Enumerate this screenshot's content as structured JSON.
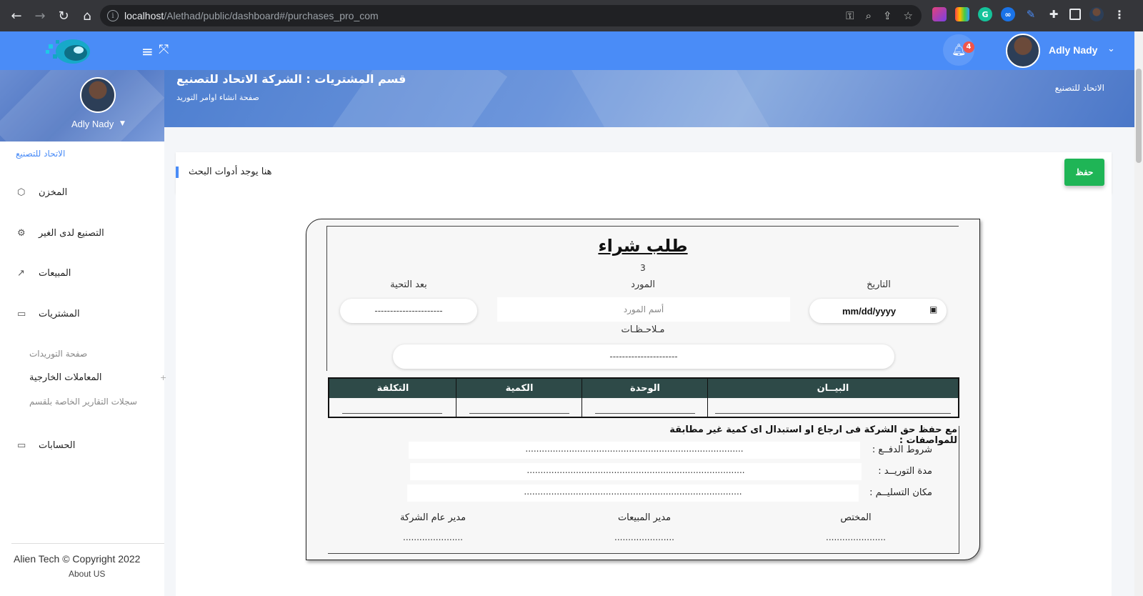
{
  "browser": {
    "url_host": "localhost",
    "url_path": "/Alethad/public/dashboard#/purchases_pro_com"
  },
  "topbar": {
    "user_name": "Adly Nady",
    "notification_count": "4"
  },
  "banner": {
    "title": "قسم المشتريات : الشركة الاتحاد للتصنيع",
    "subtitle": "صفحة انشاء اوامر التوريد",
    "breadcrumb": "الاتحاد للتصنيع"
  },
  "sidebar": {
    "user_name": "Adly Nady",
    "company": "الاتحاد للتصنيع",
    "items": [
      {
        "label": "المخزن",
        "icon": "box-icon"
      },
      {
        "label": "التصنيع لدى الغير",
        "icon": "gear-icon"
      },
      {
        "label": "المبيعات",
        "icon": "chart-line-icon"
      },
      {
        "label": "المشتريات",
        "icon": "card-icon"
      },
      {
        "label": "الحسابات",
        "icon": "card-icon"
      }
    ],
    "sub_items": [
      {
        "label": "صفحة التوريدات"
      },
      {
        "label": "المعاملات الخارجية"
      },
      {
        "label": "سجلات التقارير الخاصة بلقسم"
      }
    ],
    "copyright": "Alien Tech © Copyright 2022",
    "about": "About US"
  },
  "toolbar": {
    "search_title": "هنا يوجد أدوات البحث",
    "save_label": "حفظ"
  },
  "form": {
    "title": "طلب شراء",
    "number": "3",
    "date_label": "التاريخ",
    "date_placeholder": "mm/dd/yyyy",
    "supplier_label": "المورد",
    "supplier_placeholder": "أسم المورد",
    "greeting_label": "بعد التحية",
    "greeting_value": "----------------------",
    "notes_label": "مـلاحـظـات",
    "notes_value": "----------------------",
    "table_headers": [
      "البيــان",
      "الوحدة",
      "الكمية",
      "التكلفة"
    ],
    "notice": "مع حفظ حق الشركة فى ارجاع او استبدال اى كمية غير مطابقة للمواصفات :",
    "terms": [
      {
        "label": "شروط الدفــع :",
        "value": "................................................................................"
      },
      {
        "label": "مدة التوريــد :",
        "value": "................................................................................"
      },
      {
        "label": "مكان التسليــم :",
        "value": "................................................................................"
      }
    ],
    "signatures": [
      {
        "label": "المختص",
        "value": "......................"
      },
      {
        "label": "مدير المبيعات",
        "value": "......................"
      },
      {
        "label": "مدير عام الشركة",
        "value": "......................"
      }
    ]
  },
  "colors": {
    "primary": "#4a8cf7",
    "save": "#1fb556",
    "table_header": "#2e4a48"
  }
}
